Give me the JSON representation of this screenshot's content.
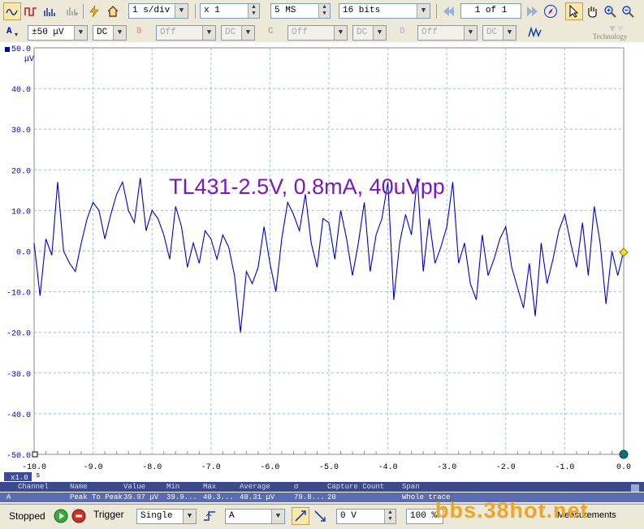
{
  "toolbar": {
    "timebase": "1 s/div",
    "zoom": "x 1",
    "samples": "5 MS",
    "resolution": "16 bits",
    "page": "1 of 1",
    "logo_caption": "Technology"
  },
  "channels": {
    "a": {
      "label": "A",
      "range": "±50 μV",
      "coupling": "DC"
    },
    "b": {
      "label": "B",
      "range": "Off",
      "coupling": "DC"
    },
    "c": {
      "label": "C",
      "range": "Off",
      "coupling": "DC"
    },
    "d": {
      "label": "D",
      "range": "Off",
      "coupling": "DC"
    }
  },
  "plot": {
    "title": "TL431-2.5V, 0.8mA, 40uVpp",
    "y_unit": "μV",
    "x_unit": "s",
    "zoom_badge": "x1.0",
    "trace_color": "#0000cc"
  },
  "chart_data": {
    "type": "line",
    "title": "TL431-2.5V, 0.8mA, 40uVpp",
    "xlabel": "s",
    "ylabel": "μV",
    "xlim": [
      -10.0,
      0.0
    ],
    "ylim": [
      -50.0,
      50.0
    ],
    "x_ticks": [
      "-10.0",
      "-9.0",
      "-8.0",
      "-7.0",
      "-6.0",
      "-5.0",
      "-4.0",
      "-3.0",
      "-2.0",
      "-1.0",
      "0.0"
    ],
    "y_ticks": [
      "50.0",
      "40.0",
      "30.0",
      "20.0",
      "10.0",
      "0.0",
      "-10.0",
      "-20.0",
      "-30.0",
      "-40.0",
      "-50.0"
    ],
    "grid": true,
    "series": [
      {
        "x": [
          -10.0,
          -9.9,
          -9.8,
          -9.7,
          -9.6,
          -9.5,
          -9.4,
          -9.3,
          -9.2,
          -9.1,
          -9.0,
          -8.9,
          -8.8,
          -8.7,
          -8.6,
          -8.5,
          -8.4,
          -8.3,
          -8.2,
          -8.1,
          -8.0,
          -7.9,
          -7.8,
          -7.7,
          -7.6,
          -7.5,
          -7.4,
          -7.3,
          -7.2,
          -7.1,
          -7.0,
          -6.9,
          -6.8,
          -6.7,
          -6.6,
          -6.5,
          -6.4,
          -6.3,
          -6.2,
          -6.1,
          -6.0,
          -5.9,
          -5.8,
          -5.7,
          -5.6,
          -5.5,
          -5.4,
          -5.3,
          -5.2,
          -5.1,
          -5.0,
          -4.9,
          -4.8,
          -4.7,
          -4.6,
          -4.5,
          -4.4,
          -4.3,
          -4.2,
          -4.1,
          -4.0,
          -3.9,
          -3.8,
          -3.7,
          -3.6,
          -3.5,
          -3.4,
          -3.3,
          -3.2,
          -3.1,
          -3.0,
          -2.9,
          -2.8,
          -2.7,
          -2.6,
          -2.5,
          -2.4,
          -2.3,
          -2.2,
          -2.1,
          -2.0,
          -1.9,
          -1.8,
          -1.7,
          -1.6,
          -1.5,
          -1.4,
          -1.3,
          -1.2,
          -1.1,
          -1.0,
          -0.9,
          -0.8,
          -0.7,
          -0.6,
          -0.5,
          -0.4,
          -0.3,
          -0.2,
          -0.1,
          0.0
        ],
        "y": [
          2,
          -11,
          3,
          -1,
          17,
          0,
          -3,
          -5,
          2,
          8,
          12,
          10,
          3,
          9,
          14,
          17,
          10,
          7,
          18,
          5,
          10,
          8,
          4,
          -2,
          11,
          6,
          -4,
          2,
          -3,
          5,
          3,
          -2,
          4,
          1,
          -6,
          -20,
          -5,
          -8,
          -4,
          6,
          -3,
          -10,
          3,
          12,
          9,
          5,
          14,
          2,
          -4,
          8,
          7,
          -2,
          10,
          3,
          -6,
          2,
          12,
          -5,
          4,
          8,
          17,
          -12,
          2,
          9,
          4,
          18,
          -5,
          8,
          -3,
          1,
          6,
          17,
          -3,
          2,
          -8,
          -12,
          4,
          -6,
          -2,
          3,
          6,
          -4,
          -9,
          -14,
          -3,
          -16,
          2,
          -8,
          -2,
          5,
          9,
          2,
          -4,
          7,
          -6,
          11,
          2,
          -13,
          0,
          -6,
          0
        ]
      }
    ]
  },
  "measurements": {
    "headers": [
      "Channel",
      "Name",
      "Value",
      "Min",
      "Max",
      "Average",
      "σ",
      "Capture Count",
      "Span"
    ],
    "rows": [
      [
        "A",
        "Peak To Peak",
        "39.97 μV",
        "39.9...",
        "40.3...",
        "40.31 μV",
        "79.8...",
        "20",
        "Whole trace"
      ]
    ]
  },
  "status": {
    "state": "Stopped",
    "trigger_label": "Trigger",
    "trigger_mode": "Single",
    "trigger_channel": "A",
    "trigger_level": "0 V",
    "trigger_percent": "100 %",
    "measure_label": "Measurements"
  },
  "watermark": "bbs.38hot.net"
}
